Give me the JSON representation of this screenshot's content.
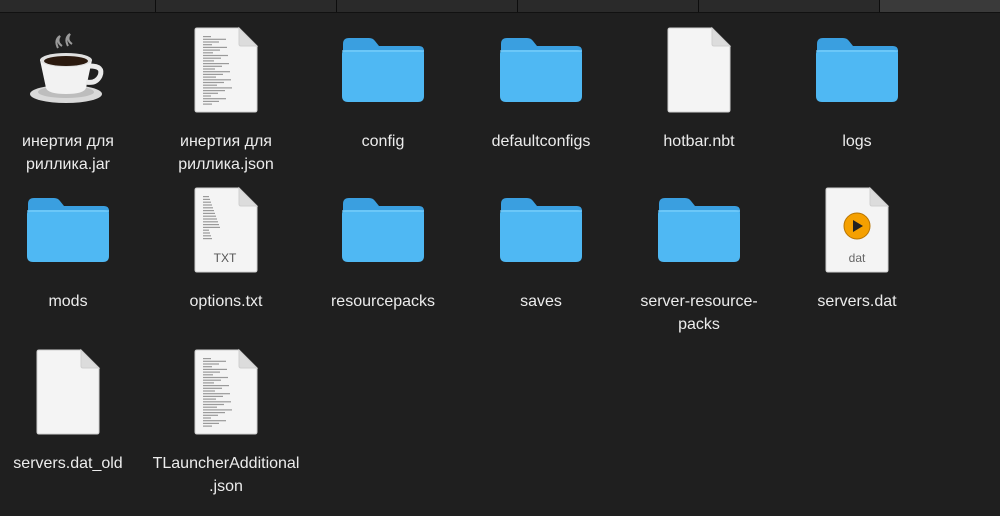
{
  "items": [
    {
      "label": "инертия для риллика.jar",
      "icon": "java-coffee-cup-icon",
      "kind": "jar"
    },
    {
      "label": "инертия для риллика.json",
      "icon": "json-document-icon",
      "kind": "json"
    },
    {
      "label": "config",
      "icon": "folder-icon",
      "kind": "folder"
    },
    {
      "label": "defaultconfigs",
      "icon": "folder-icon",
      "kind": "folder"
    },
    {
      "label": "hotbar.nbt",
      "icon": "blank-document-icon",
      "kind": "blank"
    },
    {
      "label": "logs",
      "icon": "folder-icon",
      "kind": "folder"
    },
    {
      "label": "mods",
      "icon": "folder-icon",
      "kind": "folder"
    },
    {
      "label": "options.txt",
      "icon": "text-document-icon",
      "kind": "txt",
      "badge": "TXT"
    },
    {
      "label": "resourcepacks",
      "icon": "folder-icon",
      "kind": "folder"
    },
    {
      "label": "saves",
      "icon": "folder-icon",
      "kind": "folder"
    },
    {
      "label": "server-resource-packs",
      "icon": "folder-icon",
      "kind": "folder"
    },
    {
      "label": "servers.dat",
      "icon": "media-document-icon",
      "kind": "dat",
      "badge": "dat"
    },
    {
      "label": "servers.dat_old",
      "icon": "blank-document-icon",
      "kind": "blank"
    },
    {
      "label": "TLauncherAdditional.json",
      "icon": "json-document-icon",
      "kind": "json"
    }
  ],
  "colors": {
    "background": "#1f1f1f",
    "folder_front": "#4fb8f3",
    "folder_back": "#3a9fe0",
    "doc_paper": "#f4f4f4",
    "media_accent": "#f5a000"
  }
}
